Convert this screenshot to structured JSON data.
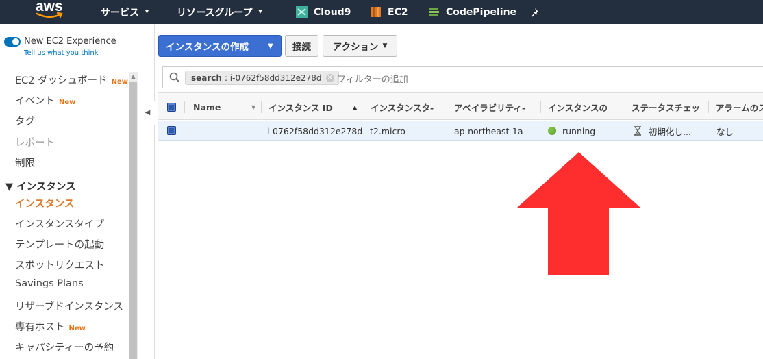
{
  "topnav": {
    "logo": "aws",
    "services": "サービス",
    "resource_groups": "リソースグループ",
    "shortcuts": [
      {
        "label": "Cloud9",
        "icon": "cloud9-icon",
        "color": "#3fae9a"
      },
      {
        "label": "EC2",
        "icon": "ec2-icon",
        "color": "#e07a26"
      },
      {
        "label": "CodePipeline",
        "icon": "codepipeline-icon",
        "color": "#6ea442"
      }
    ],
    "pin_icon": "pin-icon"
  },
  "sidebar": {
    "toggle_title": "New EC2 Experience",
    "toggle_sub": "Tell us what you think",
    "items": [
      {
        "label": "EC2 ダッシュボード",
        "badge": "New"
      },
      {
        "label": "イベント",
        "badge": "New"
      },
      {
        "label": "タグ",
        "badge": ""
      },
      {
        "label": "レポート",
        "badge": ""
      },
      {
        "label": "制限",
        "badge": ""
      }
    ],
    "section": "▼ インスタンス",
    "section_items": [
      {
        "label": "インスタンス",
        "badge": ""
      },
      {
        "label": "インスタンスタイプ",
        "badge": ""
      },
      {
        "label": "テンプレートの起動",
        "badge": ""
      },
      {
        "label": "スポットリクエスト",
        "badge": ""
      },
      {
        "label": "Savings Plans",
        "badge": ""
      },
      {
        "label": "リザーブドインスタンス",
        "badge": ""
      },
      {
        "label": "専有ホスト",
        "badge": "New"
      },
      {
        "label": "キャパシティーの予約",
        "badge": ""
      }
    ]
  },
  "toolbar": {
    "launch": "インスタンスの作成",
    "connect": "接続",
    "actions": "アクション"
  },
  "search": {
    "token_key": "search",
    "token_value": ": i-0762f58dd312e278d",
    "placeholder": "フィルターの追加"
  },
  "table": {
    "headers": [
      "Name",
      "インスタンス ID",
      "インスタンスタ-",
      "アベイラビリティ-",
      "インスタンスの",
      "ステータスチェッ",
      "アラームのス"
    ],
    "rows": [
      {
        "name": "",
        "instance_id": "i-0762f58dd312e278d",
        "instance_type": "t2.micro",
        "availability_zone": "ap-northeast-1a",
        "state": "running",
        "status_check": "初期化し...",
        "alarm": "なし"
      }
    ]
  },
  "colors": {
    "nav_bg": "#232f3e",
    "primary": "#3b6fd1",
    "running": "#7ac043",
    "active_link": "#dd7a2c",
    "annotation_arrow": "#ff2e2e"
  }
}
